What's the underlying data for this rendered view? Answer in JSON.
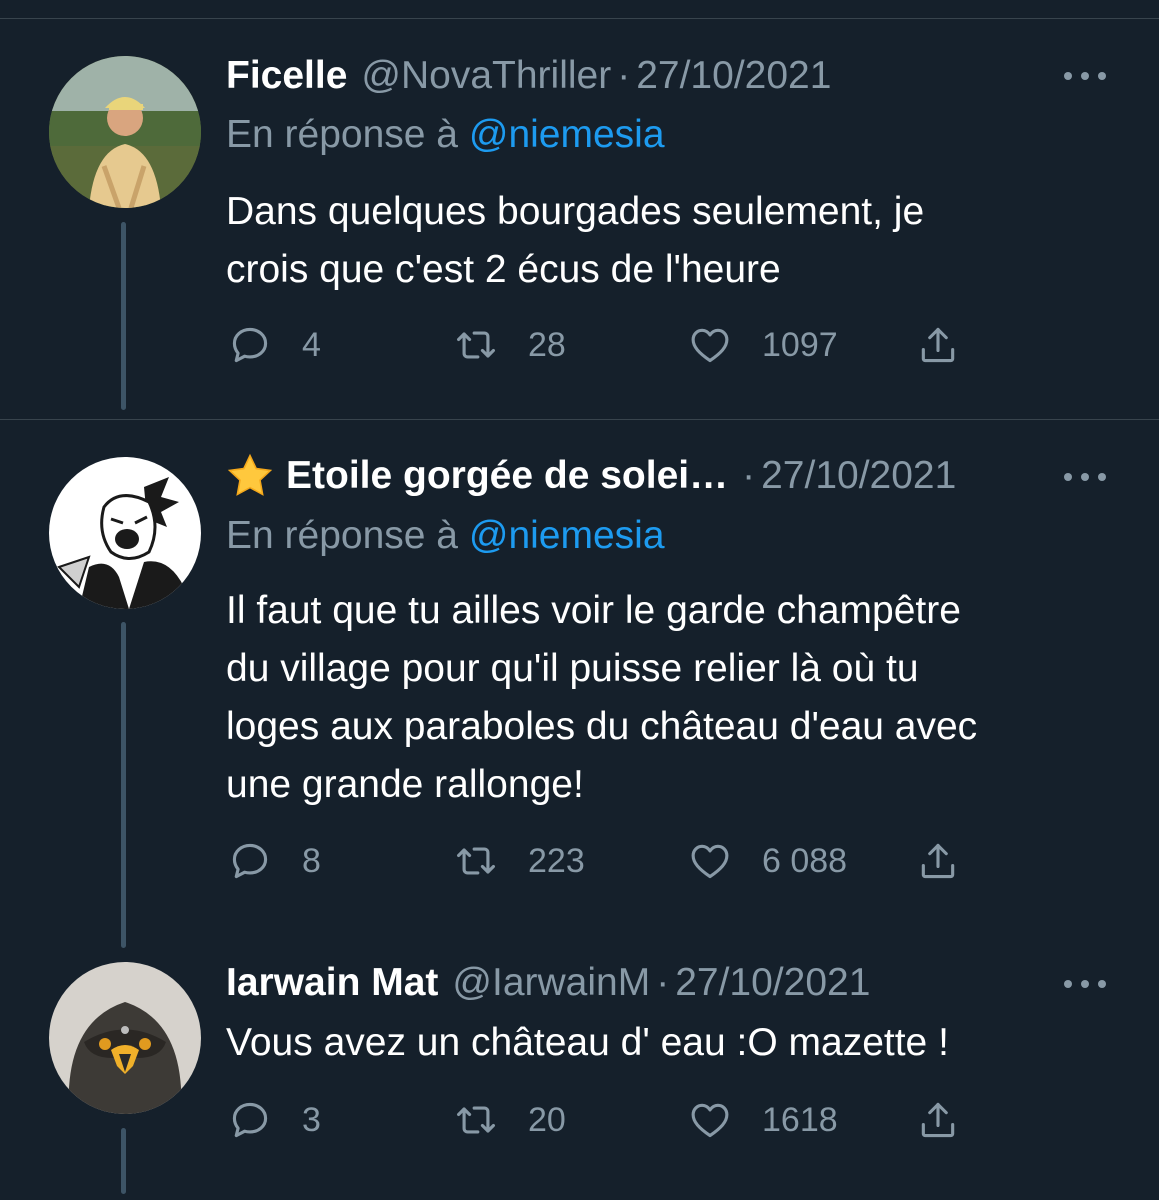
{
  "colors": {
    "background": "#15202b",
    "divider": "#38444d",
    "secondary_text": "#8899a6",
    "mention": "#1d9bf0",
    "primary_text": "#ffffff"
  },
  "reply_prefix": "En réponse à",
  "tweets": [
    {
      "display_name": "Ficelle",
      "handle": "@NovaThriller",
      "separator": "·",
      "date": "27/10/2021",
      "reply_to": "@niemesia",
      "text_lines": [
        "Dans quelques bourgades seulement, je",
        "crois que c'est 2 écus de l'heure"
      ],
      "replies": "4",
      "retweets": "28",
      "likes": "1097",
      "avatar_icon": "avatar-photo-person"
    },
    {
      "display_name": "Etoile gorgée de solei…",
      "name_emoji_icon": "star-icon",
      "handle": "",
      "separator": "·",
      "date": "27/10/2021",
      "reply_to": "@niemesia",
      "text_lines": [
        "Il faut que tu ailles voir le garde champêtre",
        "du village pour qu'il puisse relier là où tu",
        "loges aux paraboles du château d'eau avec",
        "une grande rallonge!"
      ],
      "replies": "8",
      "retweets": "223",
      "likes": "6 088",
      "avatar_icon": "avatar-manga-drawing"
    },
    {
      "display_name": "Iarwain Mat",
      "handle": "@IarwainM",
      "separator": "·",
      "date": "27/10/2021",
      "text_lines": [
        "Vous avez un château d' eau :O mazette !"
      ],
      "replies": "3",
      "retweets": "20",
      "likes": "1618",
      "avatar_icon": "avatar-bird-photo"
    }
  ]
}
